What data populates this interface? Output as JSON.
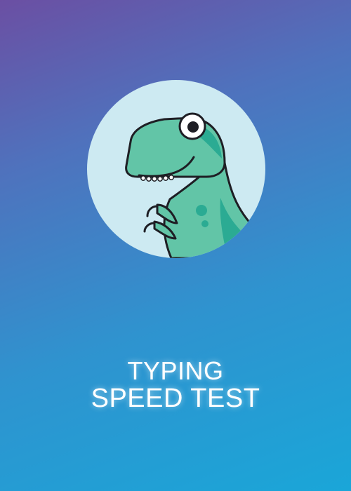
{
  "splash": {
    "mascot_icon": "dinosaur-mascot-icon",
    "title_line1": "TYPING",
    "title_line2": "SPEED TEST"
  },
  "colors": {
    "gradient_top": "#6b4fa3",
    "gradient_bottom": "#1aa6d8",
    "circle": "#cdeaf2",
    "dino_green": "#62c5a7",
    "dino_dark_green": "#2bab93",
    "outline": "#1e1e24",
    "title": "#ffffff"
  }
}
